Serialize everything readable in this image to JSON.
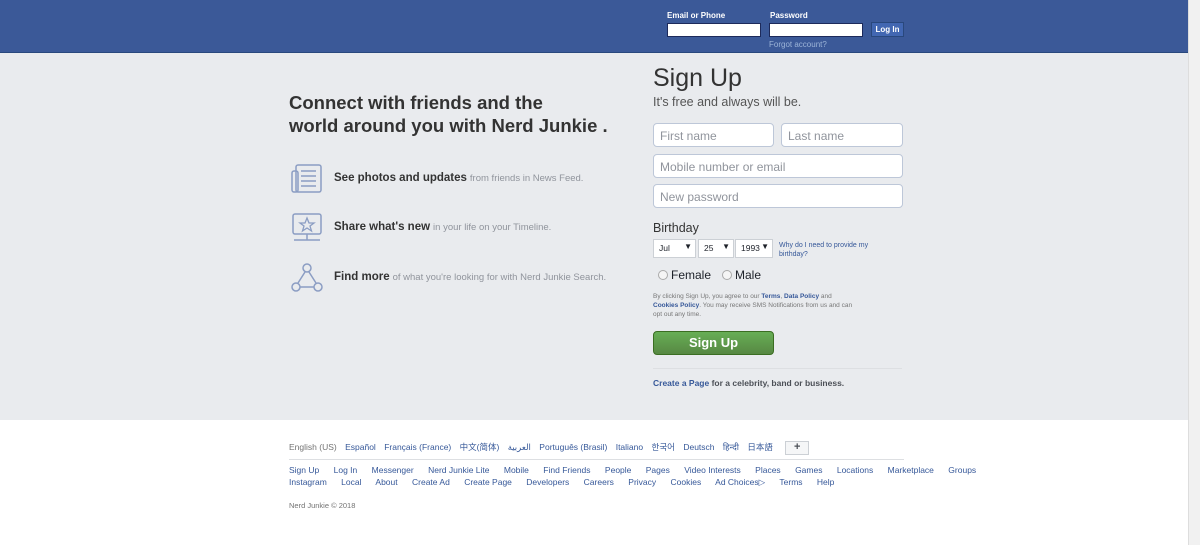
{
  "header": {
    "email_label": "Email or Phone",
    "password_label": "Password",
    "login_label": "Log In",
    "forgot_label": "Forgot account?"
  },
  "hero": {
    "headline_line1": "Connect with friends and the",
    "headline_line2": "world around you with Nerd Junkie .",
    "features": [
      {
        "title": "See photos and updates",
        "sub": "from friends in News Feed.",
        "icon": "news-feed-icon"
      },
      {
        "title": "Share what's new",
        "sub": "in your life on your Timeline.",
        "icon": "timeline-star-icon"
      },
      {
        "title": "Find more",
        "sub": "of what you're looking for with Nerd Junkie Search.",
        "icon": "search-graph-icon"
      }
    ]
  },
  "signup": {
    "title": "Sign Up",
    "subtitle": "It's free and always will be.",
    "first_name_placeholder": "First name",
    "last_name_placeholder": "Last name",
    "mobile_placeholder": "Mobile number or email",
    "password_placeholder": "New password",
    "birthday_label": "Birthday",
    "month": "Jul",
    "day": "25",
    "year": "1993",
    "why_birthday": "Why do I need to provide my birthday?",
    "female_label": "Female",
    "male_label": "Male",
    "terms_pre": "By clicking Sign Up, you agree to our ",
    "terms_link": "Terms",
    "terms_mid": ", ",
    "data_policy_link": "Data Policy",
    "terms_and": " and ",
    "cookies_policy_link": "Cookies Policy",
    "terms_post": ". You may receive SMS Notifications from us and can opt out any time.",
    "button_label": "Sign Up",
    "create_page_link": "Create a Page",
    "create_page_rest": " for a celebrity, band or business."
  },
  "footer": {
    "languages": [
      "English (US)",
      "Español",
      "Français (France)",
      "中文(简体)",
      "العربية",
      "Português (Brasil)",
      "Italiano",
      "한국어",
      "Deutsch",
      "हिन्दी",
      "日本語"
    ],
    "more_languages": "+",
    "links_row1": [
      "Sign Up",
      "Log In",
      "Messenger",
      "Nerd Junkie Lite",
      "Mobile",
      "Find Friends",
      "People",
      "Pages",
      "Video Interests",
      "Places",
      "Games",
      "Locations",
      "Marketplace",
      "Groups"
    ],
    "links_row2": [
      "Instagram",
      "Local",
      "About",
      "Create Ad",
      "Create Page",
      "Developers",
      "Careers",
      "Privacy",
      "Cookies",
      "Ad Choices▷",
      "Terms",
      "Help"
    ],
    "copyright": "Nerd Junkie © 2018"
  },
  "colors": {
    "brand_blue": "#3b5998",
    "signup_green": "#5ea246",
    "link_blue": "#365899",
    "background_gray": "#e9ebee"
  }
}
